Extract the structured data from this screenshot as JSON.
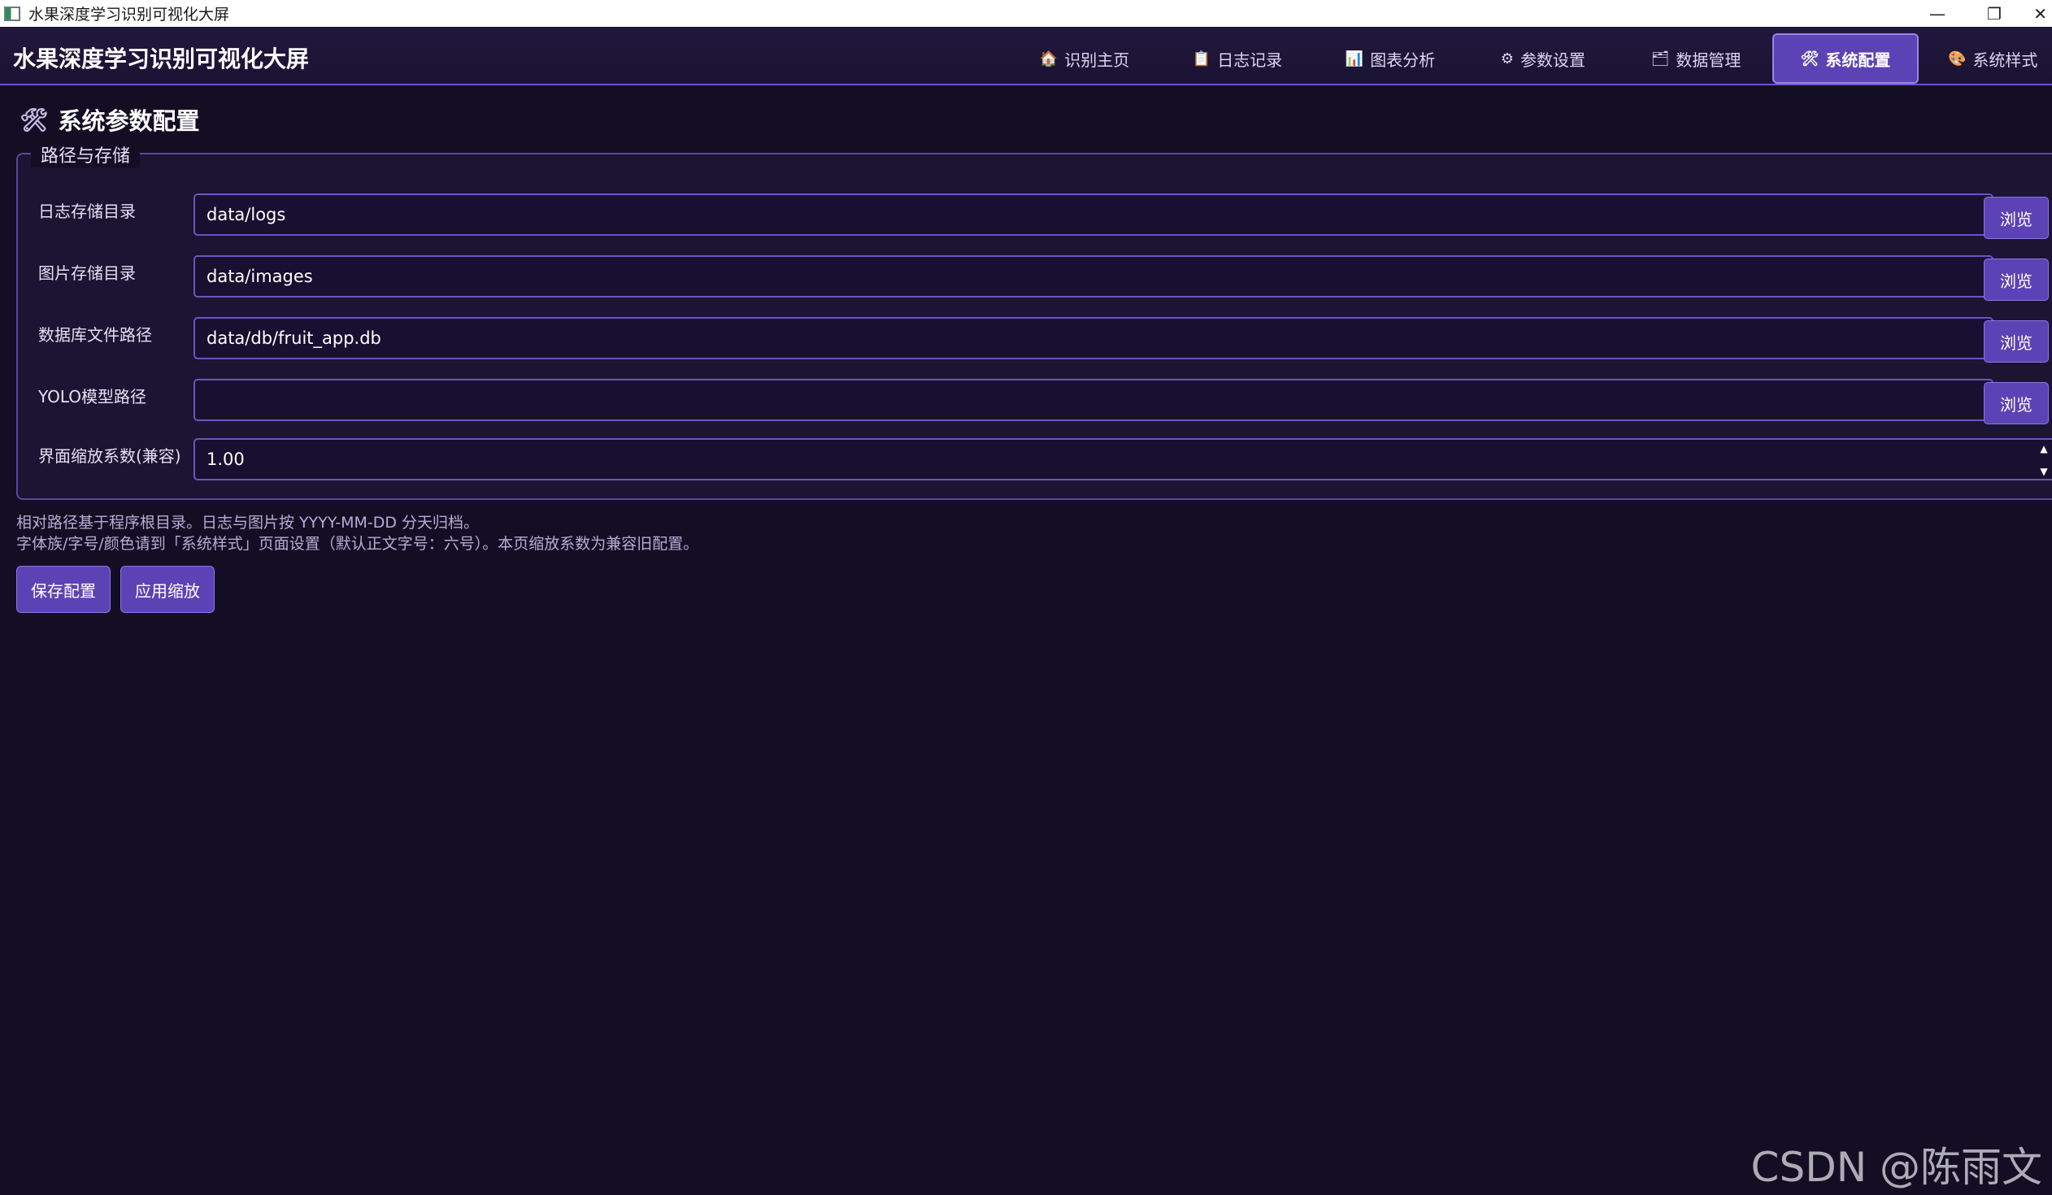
{
  "window": {
    "title": "水果深度学习识别可视化大屏",
    "minimize": "—",
    "restore": "❐",
    "close": "✕"
  },
  "header": {
    "title": "水果深度学习识别可视化大屏",
    "tabs": [
      {
        "icon": "🏠",
        "label": "识别主页",
        "active": false
      },
      {
        "icon": "📋",
        "label": "日志记录",
        "active": false
      },
      {
        "icon": "📊",
        "label": "图表分析",
        "active": false
      },
      {
        "icon": "⚙",
        "label": "参数设置",
        "active": false
      },
      {
        "icon": "🗂",
        "label": "数据管理",
        "active": false
      },
      {
        "icon": "🛠",
        "label": "系统配置",
        "active": true
      },
      {
        "icon": "🎨",
        "label": "系统样式",
        "active": false
      }
    ]
  },
  "page": {
    "icon": "🛠",
    "title": "系统参数配置"
  },
  "group": {
    "legend": "路径与存储",
    "rows": [
      {
        "label": "日志存储目录",
        "value": "data/logs",
        "button": "浏览"
      },
      {
        "label": "图片存储目录",
        "value": "data/images",
        "button": "浏览"
      },
      {
        "label": "数据库文件路径",
        "value": "data/db/fruit_app.db",
        "button": "浏览"
      },
      {
        "label": "YOLO模型路径",
        "value": "",
        "button": "浏览"
      }
    ],
    "scale": {
      "label": "界面缩放系数(兼容)",
      "value": "1.00",
      "up": "▲",
      "down": "▼"
    }
  },
  "hints": [
    "相对路径基于程序根目录。日志与图片按 YYYY-MM-DD 分天归档。",
    "字体族/字号/颜色请到「系统样式」页面设置（默认正文字号：六号）。本页缩放系数为兼容旧配置。"
  ],
  "actions": {
    "save": "保存配置",
    "apply": "应用缩放"
  },
  "watermark": "CSDN @陈雨文"
}
